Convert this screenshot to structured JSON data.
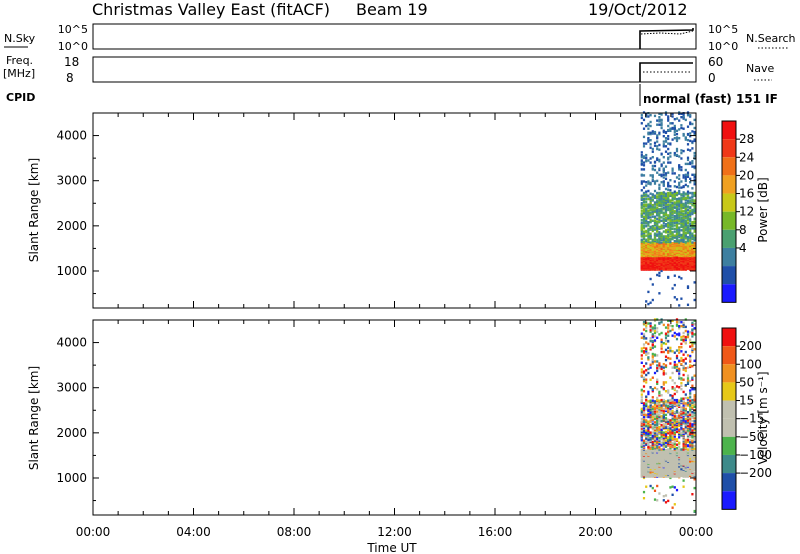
{
  "header": {
    "station": "Christmas Valley East (fitACF)",
    "beam": "Beam 19",
    "date": "19/Oct/2012"
  },
  "top_panels": {
    "nsky": {
      "label": "N.Sky",
      "right_label": "N.Search",
      "left_ticks": [
        "10^5",
        "10^0"
      ],
      "right_ticks": [
        "10^5",
        "10^0"
      ]
    },
    "freq": {
      "label_line1": "Freq.",
      "label_line2": "[MHz]",
      "right_label": "Nave",
      "left_ticks": [
        "18",
        "8"
      ],
      "right_ticks": [
        "60",
        "0"
      ]
    },
    "cpid": {
      "label": "CPID",
      "value": "normal (fast) 151 IF"
    }
  },
  "colors": {
    "power_scale": [
      "#1a1aff",
      "#1f4fa8",
      "#3d7fa0",
      "#4aa070",
      "#77b828",
      "#c8c818",
      "#f0a020",
      "#f07018",
      "#f03818",
      "#f01010"
    ],
    "velocity_scale": [
      "#1a1aff",
      "#1f4fa8",
      "#3d8a8a",
      "#4cb34c",
      "#c0c0b0",
      "#c0c0b0",
      "#e6c818",
      "#f09020",
      "#f05818",
      "#f01010"
    ]
  },
  "chart_data": [
    {
      "type": "heatmap",
      "panel": "power",
      "xlabel": "Time UT",
      "ylabel": "Slant Range [km]",
      "x_ticks": [
        "00:00",
        "04:00",
        "08:00",
        "12:00",
        "16:00",
        "20:00",
        "00:00"
      ],
      "x_range_hours": [
        0,
        24
      ],
      "y_ticks": [
        1000,
        2000,
        3000,
        4000
      ],
      "y_range_km": [
        180,
        4500
      ],
      "data_x_range_hours": [
        21.8,
        24
      ],
      "colorbar": {
        "label": "Power [dB]",
        "ticks": [
          "28",
          "24",
          "20",
          "16",
          "12",
          "8",
          "4"
        ],
        "range": [
          0,
          32
        ]
      }
    },
    {
      "type": "heatmap",
      "panel": "velocity",
      "xlabel": "Time UT",
      "ylabel": "Slant Range [km]",
      "x_ticks": [
        "00:00",
        "04:00",
        "08:00",
        "12:00",
        "16:00",
        "20:00",
        "00:00"
      ],
      "x_range_hours": [
        0,
        24
      ],
      "y_ticks": [
        1000,
        2000,
        3000,
        4000
      ],
      "y_range_km": [
        180,
        4500
      ],
      "data_x_range_hours": [
        21.8,
        24
      ],
      "colorbar": {
        "label": "Velocity [m s⁻¹]",
        "ticks": [
          "200",
          "100",
          "50",
          "15",
          "−15",
          "−50",
          "−100",
          "−200"
        ]
      }
    }
  ]
}
